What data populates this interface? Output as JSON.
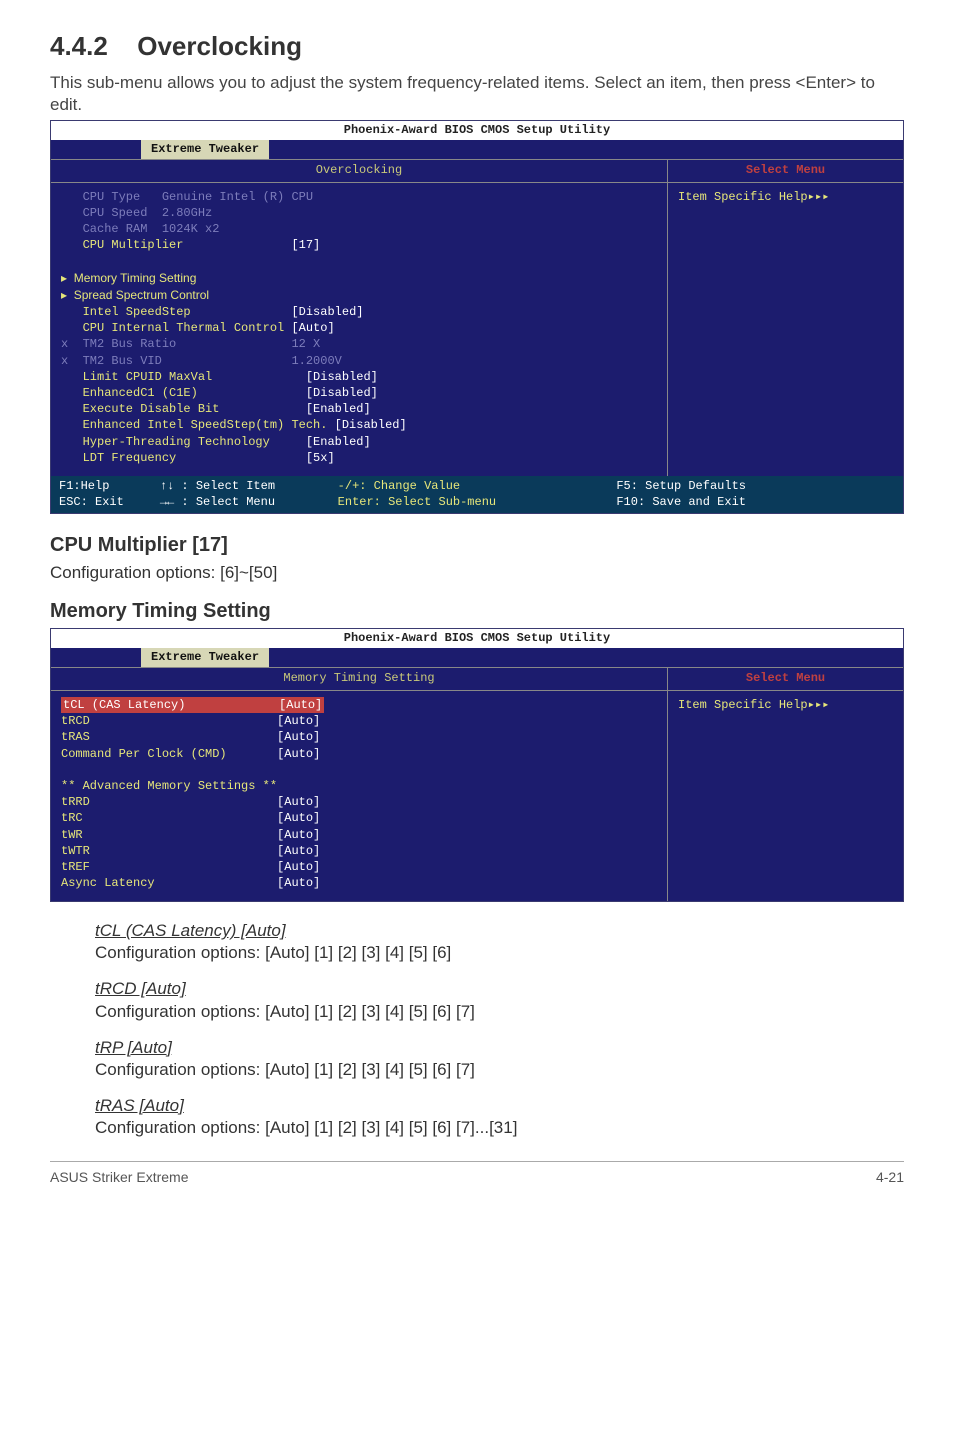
{
  "section": {
    "number": "4.4.2",
    "title": "Overclocking"
  },
  "intro": "This sub-menu allows you to adjust the system frequency-related items. Select an item, then press <Enter> to edit.",
  "bios1": {
    "util_title": "Phoenix-Award BIOS CMOS Setup Utility",
    "tab": "Extreme Tweaker",
    "left_header": "Overclocking",
    "right_header": "Select Menu",
    "right_body": "Item Specific Help▸▸▸",
    "lines": {
      "cpu_type": "   CPU Type   Genuine Intel (R) CPU",
      "cpu_speed": "   CPU Speed  2.80GHz",
      "cache_ram": "   Cache RAM  1024K x2",
      "cpu_mult_l": "   CPU Multiplier",
      "cpu_mult_v": "[17]",
      "mts": "▸  Memory Timing Setting",
      "ssc": "▸  Spread Spectrum Control",
      "iss_l": "   Intel SpeedStep",
      "iss_v": "[Disabled]",
      "citc_l": "   CPU Internal Thermal Control",
      "citc_v": "[Auto]",
      "tm2r_l": "x  TM2 Bus Ratio",
      "tm2r_v": "12 X",
      "tm2v_l": "x  TM2 Bus VID",
      "tm2v_v": "1.2000V",
      "lcm_l": "   Limit CPUID MaxVal",
      "lcm_v": "[Disabled]",
      "ec1_l": "   EnhancedC1 (C1E)",
      "ec1_v": "[Disabled]",
      "edb_l": "   Execute Disable Bit",
      "edb_v": "[Enabled]",
      "eist_l": "   Enhanced Intel SpeedStep(tm) Tech.",
      "eist_v": "[Disabled]",
      "htt_l": "   Hyper-Threading Technology",
      "htt_v": "[Enabled]",
      "ldt_l": "   LDT Frequency",
      "ldt_v": "[5x]"
    },
    "footer": {
      "c1a": "F1:Help       ↑↓ : Select Item",
      "c1b": "ESC: Exit     →← : Select Menu",
      "c2a": "-/+: Change Value",
      "c2b": "Enter: Select Sub-menu",
      "c3a": "F5: Setup Defaults",
      "c3b": "F10: Save and Exit"
    }
  },
  "cpu_mult": {
    "heading": "CPU Multiplier [17]",
    "opts": "Configuration options: [6]~[50]"
  },
  "mem_heading": "Memory Timing Setting",
  "bios2": {
    "util_title": "Phoenix-Award BIOS CMOS Setup Utility",
    "tab": "Extreme Tweaker",
    "left_header": "Memory Timing Setting",
    "right_header": "Select Menu",
    "right_body": "Item Specific Help▸▸▸",
    "lines": {
      "tcl_l": "tCL (CAS Latency)",
      "tcl_v": "[Auto]",
      "trcd_l": "tRCD",
      "trcd_v": "[Auto]",
      "tras_l": "tRAS",
      "tras_v": "[Auto]",
      "cmd_l": "Command Per Clock (CMD)",
      "cmd_v": "[Auto]",
      "adv": "** Advanced Memory Settings **",
      "trrd_l": "tRRD",
      "trrd_v": "[Auto]",
      "trc_l": "tRC",
      "trc_v": "[Auto]",
      "twr_l": "tWR",
      "twr_v": "[Auto]",
      "twtr_l": "tWTR",
      "twtr_v": "[Auto]",
      "tref_l": "tREF",
      "tref_v": "[Auto]",
      "al_l": "Async Latency",
      "al_v": "[Auto]"
    }
  },
  "params": {
    "tcl": {
      "h": "tCL (CAS Latency) [Auto]",
      "o": "Configuration options: [Auto] [1] [2] [3] [4] [5] [6]"
    },
    "trcd": {
      "h": "tRCD [Auto]",
      "o": "Configuration options: [Auto] [1] [2] [3] [4] [5] [6] [7]"
    },
    "trp": {
      "h": "tRP [Auto]",
      "o": "Configuration options: [Auto] [1] [2] [3] [4] [5] [6] [7]"
    },
    "tras": {
      "h": "tRAS [Auto]",
      "o": "Configuration options: [Auto] [1] [2] [3] [4] [5] [6] [7]...[31]"
    }
  },
  "footer": {
    "left": "ASUS Striker Extreme",
    "right": "4-21"
  }
}
